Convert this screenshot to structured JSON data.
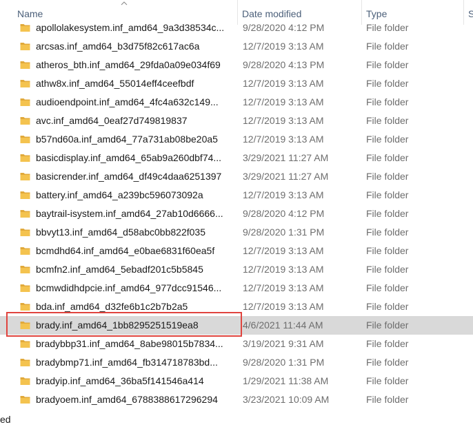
{
  "columns": {
    "name": "Name",
    "date": "Date modified",
    "type": "Type",
    "size": "S"
  },
  "colors": {
    "folder": "#f4c34f",
    "selected_row": "#d9d9d9",
    "highlight_border": "#e0443e",
    "header_text": "#4c607a"
  },
  "icons": {
    "folder": "folder-icon",
    "sort": "sort-ascending-icon"
  },
  "rows": [
    {
      "name": "apollolakesystem.inf_amd64_9a3d38534c...",
      "date": "9/28/2020 4:12 PM",
      "type": "File folder"
    },
    {
      "name": "arcsas.inf_amd64_b3d75f82c617ac6a",
      "date": "12/7/2019 3:13 AM",
      "type": "File folder"
    },
    {
      "name": "atheros_bth.inf_amd64_29fda0a09e034f69",
      "date": "9/28/2020 4:13 PM",
      "type": "File folder"
    },
    {
      "name": "athw8x.inf_amd64_55014eff4ceefbdf",
      "date": "12/7/2019 3:13 AM",
      "type": "File folder"
    },
    {
      "name": "audioendpoint.inf_amd64_4fc4a632c149...",
      "date": "12/7/2019 3:13 AM",
      "type": "File folder"
    },
    {
      "name": "avc.inf_amd64_0eaf27d749819837",
      "date": "12/7/2019 3:13 AM",
      "type": "File folder"
    },
    {
      "name": "b57nd60a.inf_amd64_77a731ab08be20a5",
      "date": "12/7/2019 3:13 AM",
      "type": "File folder"
    },
    {
      "name": "basicdisplay.inf_amd64_65ab9a260dbf74...",
      "date": "3/29/2021 11:27 AM",
      "type": "File folder"
    },
    {
      "name": "basicrender.inf_amd64_df49c4daa6251397",
      "date": "3/29/2021 11:27 AM",
      "type": "File folder"
    },
    {
      "name": "battery.inf_amd64_a239bc596073092a",
      "date": "12/7/2019 3:13 AM",
      "type": "File folder"
    },
    {
      "name": "baytrail-isystem.inf_amd64_27ab10d6666...",
      "date": "9/28/2020 4:12 PM",
      "type": "File folder"
    },
    {
      "name": "bbvyt13.inf_amd64_d58abc0bb822f035",
      "date": "9/28/2020 1:31 PM",
      "type": "File folder"
    },
    {
      "name": "bcmdhd64.inf_amd64_e0bae6831f60ea5f",
      "date": "12/7/2019 3:13 AM",
      "type": "File folder"
    },
    {
      "name": "bcmfn2.inf_amd64_5ebadf201c5b5845",
      "date": "12/7/2019 3:13 AM",
      "type": "File folder"
    },
    {
      "name": "bcmwdidhdpcie.inf_amd64_977dcc91546...",
      "date": "12/7/2019 3:13 AM",
      "type": "File folder"
    },
    {
      "name": "bda.inf_amd64_d32fe6b1c2b7b2a5",
      "date": "12/7/2019 3:13 AM",
      "type": "File folder"
    },
    {
      "name": "brady.inf_amd64_1bb8295251519ea8",
      "date": "4/6/2021 11:44 AM",
      "type": "File folder",
      "selected": true
    },
    {
      "name": "bradybbp31.inf_amd64_8abe98015b7834...",
      "date": "3/19/2021 9:31 AM",
      "type": "File folder"
    },
    {
      "name": "bradybmp71.inf_amd64_fb314718783bd...",
      "date": "9/28/2020 1:31 PM",
      "type": "File folder"
    },
    {
      "name": "bradyip.inf_amd64_36ba5f141546a414",
      "date": "1/29/2021 11:38 AM",
      "type": "File folder"
    },
    {
      "name": "bradyoem.inf_amd64_6788388617296294",
      "date": "3/23/2021 10:09 AM",
      "type": "File folder"
    }
  ],
  "status": {
    "text": "ed"
  }
}
